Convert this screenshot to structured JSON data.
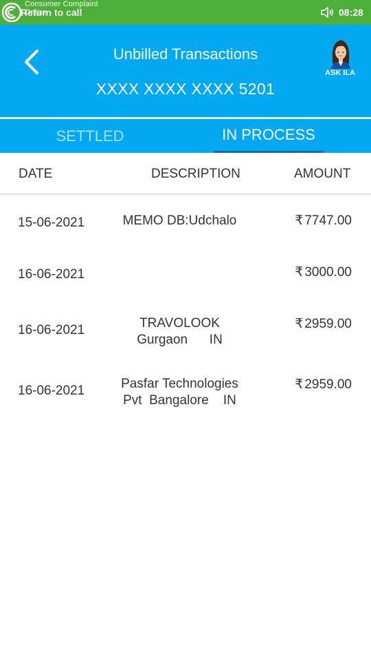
{
  "status_bar": {
    "brand_line1": "Consumer Complaint",
    "brand_line2": "Online",
    "return_to_call": "Return to call",
    "time": "08:28"
  },
  "header": {
    "title": "Unbilled Transactions",
    "card_number": "XXXX XXXX XXXX 5201",
    "ask_label": "ASK ILA"
  },
  "tabs": [
    {
      "label": "SETTLED",
      "selected": false
    },
    {
      "label": "IN PROCESS",
      "selected": true
    }
  ],
  "table": {
    "columns": {
      "date": "DATE",
      "description": "DESCRIPTION",
      "amount": "AMOUNT"
    },
    "currency_symbol": "₹",
    "rows": [
      {
        "date": "15-06-2021",
        "description": "MEMO DB:Udchalo",
        "amount": "7747.00"
      },
      {
        "date": "16-06-2021",
        "description": "",
        "amount": "3000.00"
      },
      {
        "date": "16-06-2021",
        "description": "TRAVOLOOK\nGurgaon      IN",
        "amount": "2959.00"
      },
      {
        "date": "16-06-2021",
        "description": "Pasfar Technologies\nPvt  Bangalore    IN",
        "amount": "2959.00"
      }
    ]
  },
  "colors": {
    "status_bar": "#4caf37",
    "header": "#03a9f0",
    "tab_indicator": "#0b6ea8"
  },
  "icons": [
    "cco-logo-icon",
    "volume-icon",
    "back-arrow-icon",
    "ask-ila-avatar-icon"
  ]
}
